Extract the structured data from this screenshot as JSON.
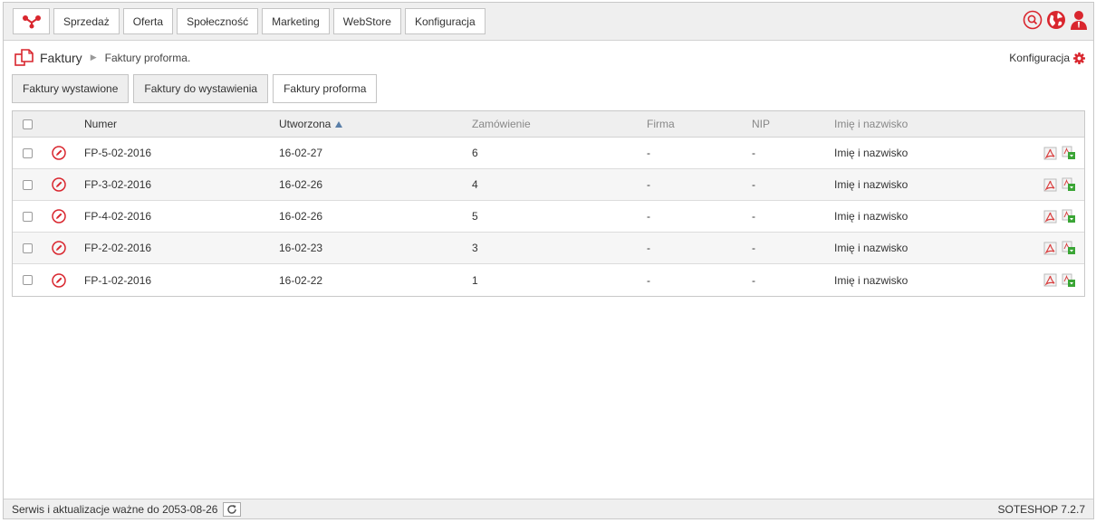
{
  "colors": {
    "brand_red": "#d9262e",
    "sort_arrow": "#5a7fa8",
    "pdf_icon": "#d94040",
    "download_green": "#3aa535"
  },
  "nav": {
    "logo_icon": "soteshop-logo-icon",
    "items": [
      {
        "label": "Sprzedaż"
      },
      {
        "label": "Oferta"
      },
      {
        "label": "Społeczność"
      },
      {
        "label": "Marketing"
      },
      {
        "label": "WebStore"
      },
      {
        "label": "Konfiguracja"
      }
    ],
    "icons": [
      "search-icon",
      "globe-icon",
      "user-icon"
    ]
  },
  "breadcrumb": {
    "icon": "invoice-icon",
    "title": "Faktury",
    "separator": "▶",
    "current": "Faktury proforma."
  },
  "config_link": {
    "label": "Konfiguracja",
    "icon": "gear-icon"
  },
  "tabs": [
    {
      "label": "Faktury wystawione",
      "active": false
    },
    {
      "label": "Faktury do wystawienia",
      "active": false
    },
    {
      "label": "Faktury proforma",
      "active": true
    }
  ],
  "table": {
    "headers": {
      "number": "Numer",
      "created": "Utworzona",
      "order": "Zamówienie",
      "company": "Firma",
      "nip": "NIP",
      "name": "Imię i nazwisko"
    },
    "sort_column": "created",
    "sort_direction": "ascending",
    "rows": [
      {
        "number": "FP-5-02-2016",
        "created": "16-02-27",
        "order": "6",
        "company": "-",
        "nip": "-",
        "name": "Imię i nazwisko"
      },
      {
        "number": "FP-3-02-2016",
        "created": "16-02-26",
        "order": "4",
        "company": "-",
        "nip": "-",
        "name": "Imię i nazwisko"
      },
      {
        "number": "FP-4-02-2016",
        "created": "16-02-26",
        "order": "5",
        "company": "-",
        "nip": "-",
        "name": "Imię i nazwisko"
      },
      {
        "number": "FP-2-02-2016",
        "created": "16-02-23",
        "order": "3",
        "company": "-",
        "nip": "-",
        "name": "Imię i nazwisko"
      },
      {
        "number": "FP-1-02-2016",
        "created": "16-02-22",
        "order": "1",
        "company": "-",
        "nip": "-",
        "name": "Imię i nazwisko"
      }
    ]
  },
  "footer": {
    "service_text": "Serwis i aktualizacje ważne do 2053-08-26",
    "version": "SOTESHOP 7.2.7"
  }
}
